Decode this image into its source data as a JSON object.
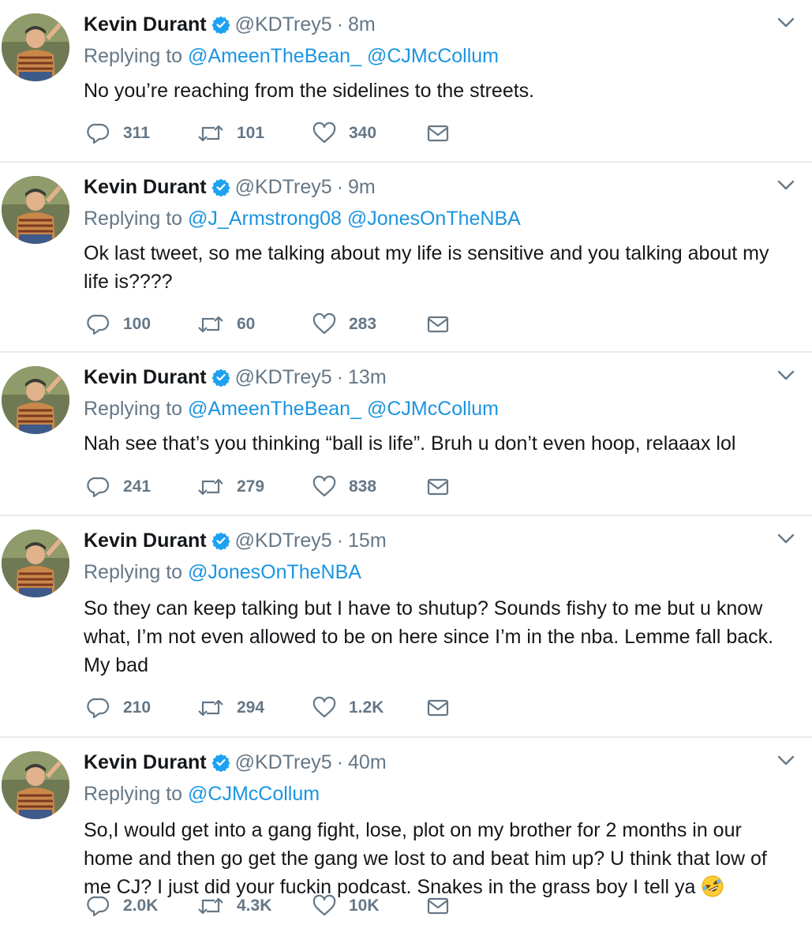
{
  "tweets": [
    {
      "name": "Kevin Durant",
      "handle": "@KDTrey5",
      "separator": "·",
      "time": "8m",
      "replying_label": "Replying to",
      "mentions": [
        "@AmeenTheBean_",
        "@CJMcCollum"
      ],
      "text": "No you’re reaching from the sidelines to the streets.",
      "replies": "311",
      "retweets": "101",
      "likes": "340"
    },
    {
      "name": "Kevin Durant",
      "handle": "@KDTrey5",
      "separator": "·",
      "time": "9m",
      "replying_label": "Replying to",
      "mentions": [
        "@J_Armstrong08",
        "@JonesOnTheNBA"
      ],
      "text": "Ok last tweet, so me talking about my life is sensitive and you talking about my life is????",
      "replies": "100",
      "retweets": "60",
      "likes": "283"
    },
    {
      "name": "Kevin Durant",
      "handle": "@KDTrey5",
      "separator": "·",
      "time": "13m",
      "replying_label": "Replying to",
      "mentions": [
        "@AmeenTheBean_",
        "@CJMcCollum"
      ],
      "text": "Nah see that’s you thinking “ball is life”. Bruh u don’t even hoop, relaaax lol",
      "replies": "241",
      "retweets": "279",
      "likes": "838"
    },
    {
      "name": "Kevin Durant",
      "handle": "@KDTrey5",
      "separator": "·",
      "time": "15m",
      "replying_label": "Replying to",
      "mentions": [
        "@JonesOnTheNBA"
      ],
      "text": "So they can keep talking but I have to shutup? Sounds fishy to me but u know what, I’m not even allowed to be on here since I’m in the nba. Lemme fall back. My bad",
      "replies": "210",
      "retweets": "294",
      "likes": "1.2K"
    },
    {
      "name": "Kevin Durant",
      "handle": "@KDTrey5",
      "separator": "·",
      "time": "40m",
      "replying_label": "Replying to",
      "mentions": [
        "@CJMcCollum"
      ],
      "text": "So,I would get into a gang fight, lose, plot on my brother for 2 months in our home and then go get the gang we lost to and beat him up? U think that low of me CJ? I just did your fuckin podcast. Snakes in the grass boy I tell ya",
      "replies": "2.0K",
      "retweets": "4.3K",
      "likes": "10K"
    }
  ],
  "colors": {
    "text": "#14171a",
    "secondary": "#657786",
    "link": "#1b95e0",
    "verified": "#1da1f2",
    "divider": "#e6ecf0"
  },
  "icons": {
    "reply": "reply-icon",
    "retweet": "retweet-icon",
    "like": "like-icon",
    "dm": "direct-message-icon",
    "verified": "verified-badge-icon",
    "caret": "chevron-down-icon",
    "emoji": "rolling-on-floor-laughing-emoji"
  }
}
